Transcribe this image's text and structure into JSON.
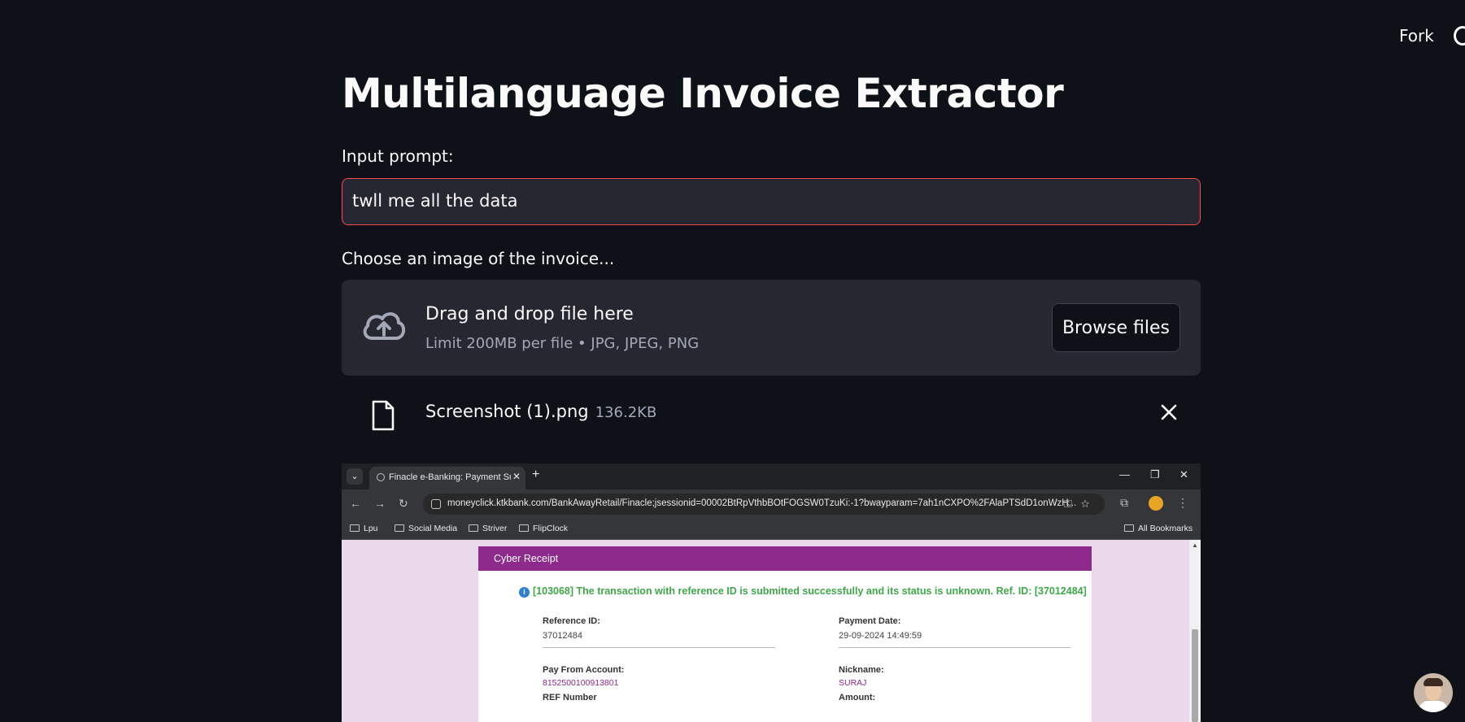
{
  "header": {
    "fork_label": "Fork",
    "github_icon": "github-icon"
  },
  "main": {
    "title": "Multilanguage Invoice Extractor",
    "prompt_label": "Input prompt:",
    "prompt_value": "twll me all the data",
    "upload_label": "Choose an image of the invoice...",
    "dropzone": {
      "title": "Drag and drop file here",
      "subtitle": "Limit 200MB per file • JPG, JPEG, PNG",
      "browse_label": "Browse files",
      "icon": "cloud-upload-icon"
    },
    "uploaded_file": {
      "name": "Screenshot (1).png",
      "size": "136.2KB",
      "icon": "file-icon"
    }
  },
  "screenshot": {
    "tab_title": "Finacle e-Banking: Payment Sur",
    "url": "moneyclick.ktkbank.com/BankAwayRetail/Finacle;jsessionid=00002BtRpVthbBOtFOGSW0TzuKi:-1?bwayparam=7ah1nCXPO%2FAlaPTSdD1onWzH...",
    "bookmarks": [
      "Lpu",
      "Social Media",
      "Striver",
      "FlipClock"
    ],
    "all_bookmarks": "All Bookmarks",
    "receipt": {
      "title": "Cyber Receipt",
      "message": "[103068] The transaction with reference ID is submitted successfully and its status is unknown. Ref. ID: [37012484]",
      "reference_id_label": "Reference ID:",
      "reference_id": "37012484",
      "payment_date_label": "Payment Date:",
      "payment_date": "29-09-2024 14:49:59",
      "pay_from_label": "Pay From Account:",
      "pay_from": "8152500100913801",
      "nickname_label": "Nickname:",
      "nickname": "SURAJ",
      "ref_number_label": "REF Number",
      "amount_label": "Amount:"
    }
  },
  "colors": {
    "background": "#0e1117",
    "accent": "#ff4b4b",
    "receipt_header": "#8e2a8c",
    "success_text": "#3fa84a"
  }
}
